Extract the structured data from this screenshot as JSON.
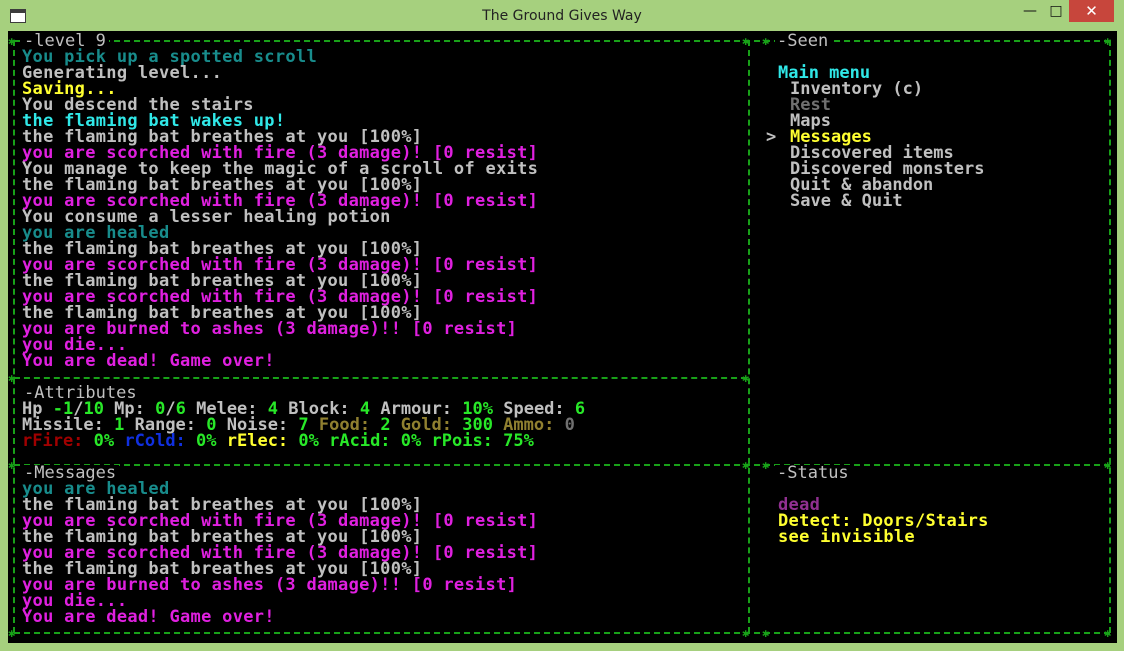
{
  "window": {
    "title": "The Ground Gives Way",
    "minimize": "—",
    "maximize": "□",
    "close": "✕"
  },
  "log_panel": {
    "title": "level 9",
    "lines": [
      {
        "text": "You pick up a spotted scroll",
        "color": "teal"
      },
      {
        "text": "Generating level...",
        "color": "white"
      },
      {
        "text": "Saving...",
        "color": "yellow"
      },
      {
        "text": "You descend the stairs",
        "color": "white"
      },
      {
        "text": "the flaming bat wakes up!",
        "color": "cyan"
      },
      {
        "text": "the flaming bat breathes at you [100%]",
        "color": "white"
      },
      {
        "text": "you are scorched with fire (3 damage)! [0 resist]",
        "color": "magenta"
      },
      {
        "text": "You manage to keep the magic of a scroll of exits",
        "color": "white"
      },
      {
        "text": "the flaming bat breathes at you [100%]",
        "color": "white"
      },
      {
        "text": "you are scorched with fire (3 damage)! [0 resist]",
        "color": "magenta"
      },
      {
        "text": "You consume a lesser healing potion",
        "color": "white"
      },
      {
        "text": "you are healed",
        "color": "teal"
      },
      {
        "text": "the flaming bat breathes at you [100%]",
        "color": "white"
      },
      {
        "text": "you are scorched with fire (3 damage)! [0 resist]",
        "color": "magenta"
      },
      {
        "text": "the flaming bat breathes at you [100%]",
        "color": "white"
      },
      {
        "text": "you are scorched with fire (3 damage)! [0 resist]",
        "color": "magenta"
      },
      {
        "text": "the flaming bat breathes at you [100%]",
        "color": "white"
      },
      {
        "text": "you are burned to ashes (3 damage)!! [0 resist]",
        "color": "magenta"
      },
      {
        "text": "you die...",
        "color": "magenta"
      },
      {
        "text": "You are dead! Game over!",
        "color": "magenta"
      }
    ]
  },
  "seen_panel": {
    "title": "Seen",
    "menu_title": "Main menu",
    "cursor": ">",
    "items": [
      {
        "label": "Inventory (c)",
        "color": "white"
      },
      {
        "label": "Rest",
        "color": "gray"
      },
      {
        "label": "Maps",
        "color": "white"
      },
      {
        "label": "Messages",
        "color": "yellow",
        "selected": true
      },
      {
        "label": "Discovered items",
        "color": "white"
      },
      {
        "label": "Discovered monsters",
        "color": "white"
      },
      {
        "label": "Quit & abandon",
        "color": "white"
      },
      {
        "label": "Save & Quit",
        "color": "white"
      }
    ]
  },
  "attributes_panel": {
    "title": "Attributes",
    "rows": [
      [
        {
          "text": "Hp ",
          "color": "white"
        },
        {
          "text": "-1",
          "color": "green"
        },
        {
          "text": "/",
          "color": "white"
        },
        {
          "text": "10",
          "color": "green"
        },
        {
          "text": " Mp: ",
          "color": "white"
        },
        {
          "text": "0",
          "color": "green"
        },
        {
          "text": "/",
          "color": "white"
        },
        {
          "text": "6",
          "color": "green"
        },
        {
          "text": " Melee: ",
          "color": "white"
        },
        {
          "text": "4",
          "color": "green"
        },
        {
          "text": " Block: ",
          "color": "white"
        },
        {
          "text": "4",
          "color": "green"
        },
        {
          "text": " Armour: ",
          "color": "white"
        },
        {
          "text": "10%",
          "color": "green"
        },
        {
          "text": " Speed: ",
          "color": "white"
        },
        {
          "text": "6",
          "color": "green"
        }
      ],
      [
        {
          "text": "Missile: ",
          "color": "white"
        },
        {
          "text": "1",
          "color": "green"
        },
        {
          "text": " Range: ",
          "color": "white"
        },
        {
          "text": "0",
          "color": "green"
        },
        {
          "text": " Noise: ",
          "color": "white"
        },
        {
          "text": "7",
          "color": "green"
        },
        {
          "text": " Food: ",
          "color": "olive"
        },
        {
          "text": "2",
          "color": "green"
        },
        {
          "text": " Gold: ",
          "color": "olive"
        },
        {
          "text": "300",
          "color": "green"
        },
        {
          "text": " Ammo: ",
          "color": "olive"
        },
        {
          "text": "0",
          "color": "gray"
        }
      ],
      [
        {
          "text": "rFire: ",
          "color": "darkred"
        },
        {
          "text": "0%",
          "color": "green"
        },
        {
          "text": " rCold: ",
          "color": "blue"
        },
        {
          "text": "0%",
          "color": "green"
        },
        {
          "text": " rElec: ",
          "color": "yellow"
        },
        {
          "text": "0%",
          "color": "green"
        },
        {
          "text": " rAcid: ",
          "color": "green"
        },
        {
          "text": "0%",
          "color": "green"
        },
        {
          "text": " rPois: ",
          "color": "green"
        },
        {
          "text": "75%",
          "color": "green"
        }
      ]
    ]
  },
  "messages_panel": {
    "title": "Messages",
    "lines": [
      {
        "text": "you are healed",
        "color": "teal"
      },
      {
        "text": "the flaming bat breathes at you [100%]",
        "color": "white"
      },
      {
        "text": "you are scorched with fire (3 damage)! [0 resist]",
        "color": "magenta"
      },
      {
        "text": "the flaming bat breathes at you [100%]",
        "color": "white"
      },
      {
        "text": "you are scorched with fire (3 damage)! [0 resist]",
        "color": "magenta"
      },
      {
        "text": "the flaming bat breathes at you [100%]",
        "color": "white"
      },
      {
        "text": "you are burned to ashes (3 damage)!! [0 resist]",
        "color": "magenta"
      },
      {
        "text": "you die...",
        "color": "magenta"
      },
      {
        "text": "You are dead! Game over!",
        "color": "magenta"
      }
    ]
  },
  "status_panel": {
    "title": "Status",
    "lines": [
      {
        "text": "dead",
        "color": "purple"
      },
      {
        "text": "Detect: Doors/Stairs",
        "color": "yellow"
      },
      {
        "text": "see invisible",
        "color": "yellow"
      }
    ]
  },
  "colors": {
    "white": "#c0c0c0",
    "yellow": "#ffff30",
    "cyan": "#30e8e8",
    "teal": "#188c8c",
    "magenta": "#e020e0",
    "green": "#28e828",
    "darkred": "#a00000",
    "blue": "#1030e0",
    "olive": "#908030",
    "gray": "#707070",
    "purple": "#903090",
    "border": "#18a018",
    "frame": "#a6d07e"
  }
}
